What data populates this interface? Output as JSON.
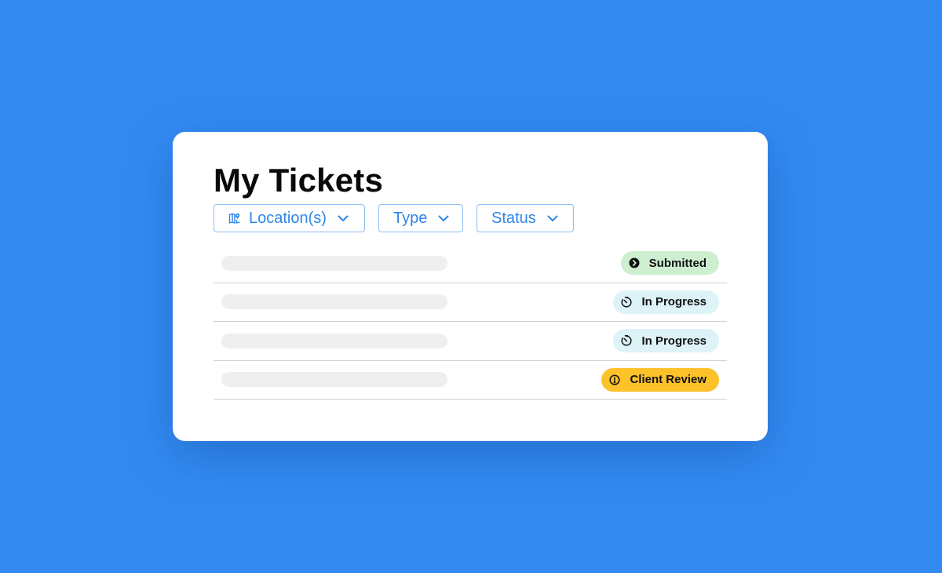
{
  "page": {
    "title": "My Tickets",
    "background_color": "#338BF2"
  },
  "filters": [
    {
      "label": "Location(s)",
      "icon": "map-pin-icon"
    },
    {
      "label": "Type"
    },
    {
      "label": "Status"
    }
  ],
  "tickets": [
    {
      "status": "Submitted",
      "status_icon": "chevron-right-circle-icon",
      "badge_color": "#CDEFD0"
    },
    {
      "status": "In Progress",
      "status_icon": "timer-icon",
      "badge_color": "#DDF3F7"
    },
    {
      "status": "In Progress",
      "status_icon": "timer-icon",
      "badge_color": "#DDF3F7"
    },
    {
      "status": "Client Review",
      "status_icon": "alert-circle-icon",
      "badge_color": "#FDC12A"
    }
  ]
}
